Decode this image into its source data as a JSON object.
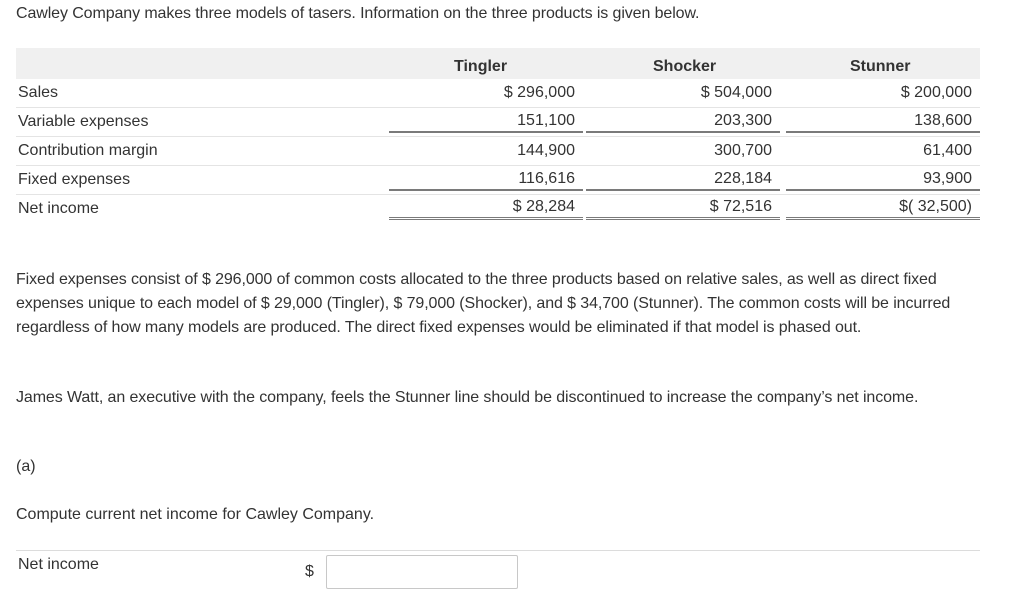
{
  "intro": "Cawley Company makes three models of tasers. Information on the three products is given below.",
  "table": {
    "columns": [
      "Tingler",
      "Shocker",
      "Stunner"
    ],
    "rows": [
      {
        "label": "Sales",
        "values": [
          "$ 296,000",
          "$ 504,000",
          "$ 200,000"
        ]
      },
      {
        "label": "Variable expenses",
        "values": [
          "151,100",
          "203,300",
          "138,600"
        ]
      },
      {
        "label": "Contribution margin",
        "values": [
          "144,900",
          "300,700",
          "61,400"
        ]
      },
      {
        "label": "Fixed expenses",
        "values": [
          "116,616",
          "228,184",
          "93,900"
        ]
      },
      {
        "label": "Net income",
        "values": [
          "$ 28,284",
          "$ 72,516",
          "$( 32,500)"
        ]
      }
    ]
  },
  "paragraph1": "Fixed expenses consist of $ 296,000 of common costs allocated to the three products based on relative sales, as well as direct fixed expenses unique to each model of $ 29,000 (Tingler), $ 79,000 (Shocker), and $ 34,700 (Stunner). The common costs will be incurred regardless of how many models are produced. The direct fixed expenses would be eliminated if that model is phased out.",
  "paragraph2": "James Watt, an executive with the company, feels the Stunner line should be discontinued to increase the company’s net income.",
  "part_label": "(a)",
  "question": "Compute current net income for Cawley Company.",
  "answer": {
    "label": "Net income",
    "currency": "$",
    "value": ""
  }
}
